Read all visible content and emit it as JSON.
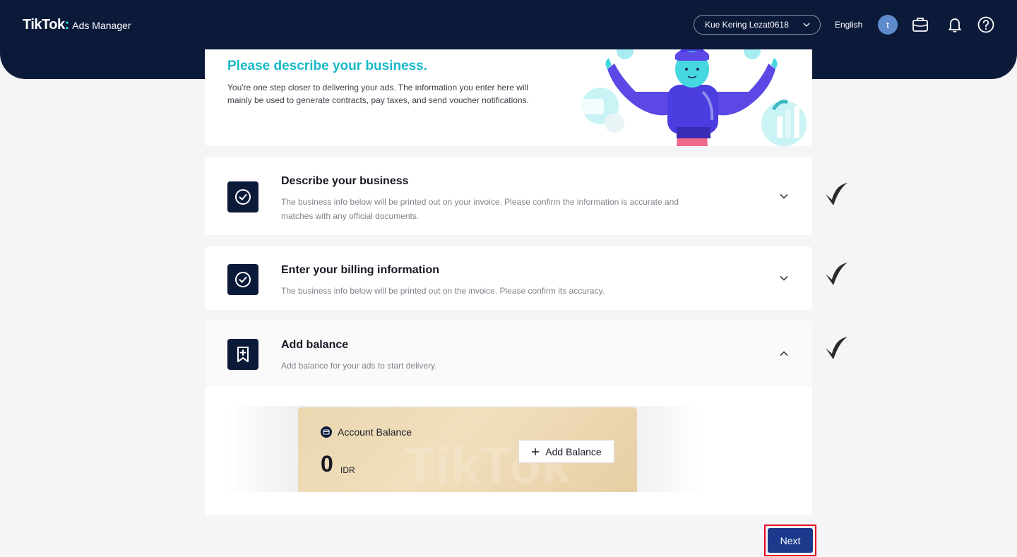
{
  "header": {
    "brand": "TikTok",
    "product": "Ads Manager",
    "account": "Kue Kering Lezat0618",
    "language": "English",
    "avatar_letter": "t",
    "icons": [
      "briefcase-icon",
      "bell-icon",
      "help-icon"
    ]
  },
  "intro": {
    "title": "Please describe your business.",
    "description": "You're one step closer to delivering your ads. The information you enter here will mainly be used to generate contracts, pay taxes, and send voucher notifications."
  },
  "steps": [
    {
      "title": "Describe your business",
      "description": "The business info below will be printed out on your invoice. Please confirm the information is accurate and matches with any official documents.",
      "expanded": false,
      "icon": "check-circle-icon"
    },
    {
      "title": "Enter your billing information",
      "description": "The business info below will be printed out on the invoice. Please confirm its accuracy.",
      "expanded": false,
      "icon": "check-circle-icon"
    },
    {
      "title": "Add balance",
      "description": "Add balance for your ads to start delivery.",
      "expanded": true,
      "icon": "bookmark-plus-icon"
    }
  ],
  "balance": {
    "label": "Account Balance",
    "amount": "0",
    "currency": "IDR",
    "add_button": "Add Balance",
    "watermark": "TikTok"
  },
  "footer": {
    "next_label": "Next"
  },
  "colors": {
    "nav_bg": "#0c1a3a",
    "accent_teal": "#18b8c8",
    "primary_button": "#1b3a8c",
    "highlight_outline": "#e8001c"
  }
}
